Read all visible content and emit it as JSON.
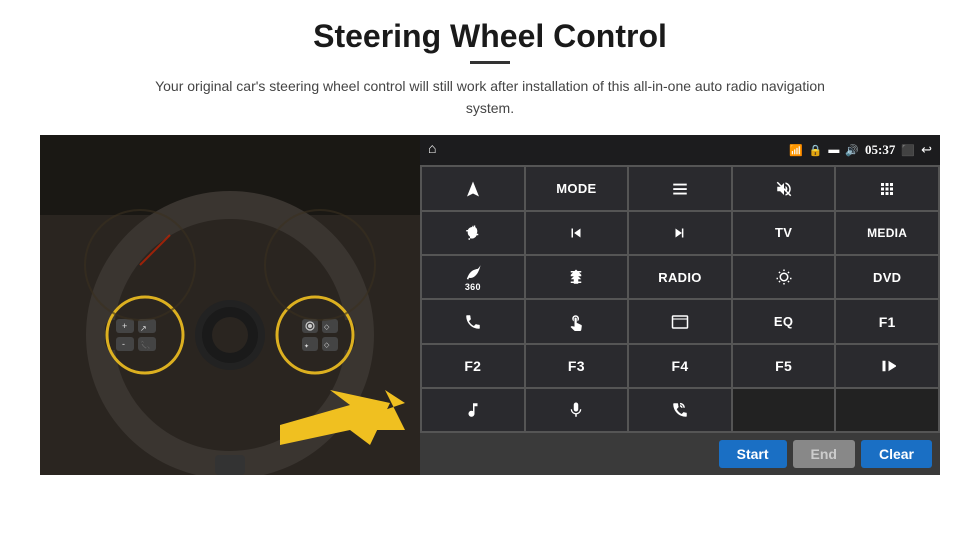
{
  "page": {
    "title": "Steering Wheel Control",
    "subtitle": "Your original car's steering wheel control will still work after installation of this all-in-one auto radio navigation system.",
    "divider": true
  },
  "status_bar": {
    "wifi_icon": "wifi",
    "lock_icon": "lock",
    "card_icon": "card",
    "bt_icon": "bluetooth-audio",
    "time": "05:37",
    "screen_icon": "screen",
    "back_icon": "back",
    "home_icon": "home"
  },
  "buttons": [
    {
      "id": "btn-home",
      "type": "icon",
      "label": "home",
      "row": 1,
      "col": 1
    },
    {
      "id": "btn-nav",
      "type": "icon",
      "label": "navigate",
      "row": 1,
      "col": 2
    },
    {
      "id": "btn-mode",
      "type": "text",
      "label": "MODE",
      "row": 1,
      "col": 3
    },
    {
      "id": "btn-list",
      "type": "icon",
      "label": "list",
      "row": 1,
      "col": 4
    },
    {
      "id": "btn-mute",
      "type": "icon",
      "label": "mute",
      "row": 1,
      "col": 5
    },
    {
      "id": "btn-apps",
      "type": "icon",
      "label": "apps",
      "row": 1,
      "col": 6
    },
    {
      "id": "btn-settings",
      "type": "icon",
      "label": "settings",
      "row": 2,
      "col": 1
    },
    {
      "id": "btn-prev",
      "type": "icon",
      "label": "previous",
      "row": 2,
      "col": 2
    },
    {
      "id": "btn-next",
      "type": "icon",
      "label": "next",
      "row": 2,
      "col": 3
    },
    {
      "id": "btn-tv",
      "type": "text",
      "label": "TV",
      "row": 2,
      "col": 4
    },
    {
      "id": "btn-media",
      "type": "text",
      "label": "MEDIA",
      "row": 2,
      "col": 5
    },
    {
      "id": "btn-360",
      "type": "text",
      "label": "360",
      "row": 3,
      "col": 1
    },
    {
      "id": "btn-eject",
      "type": "icon",
      "label": "eject",
      "row": 3,
      "col": 2
    },
    {
      "id": "btn-radio",
      "type": "text",
      "label": "RADIO",
      "row": 3,
      "col": 3
    },
    {
      "id": "btn-brightness",
      "type": "icon",
      "label": "brightness",
      "row": 3,
      "col": 4
    },
    {
      "id": "btn-dvd",
      "type": "text",
      "label": "DVD",
      "row": 3,
      "col": 5
    },
    {
      "id": "btn-phone",
      "type": "icon",
      "label": "phone",
      "row": 4,
      "col": 1
    },
    {
      "id": "btn-swipe",
      "type": "icon",
      "label": "swipe",
      "row": 4,
      "col": 2
    },
    {
      "id": "btn-resize",
      "type": "icon",
      "label": "resize",
      "row": 4,
      "col": 3
    },
    {
      "id": "btn-eq",
      "type": "text",
      "label": "EQ",
      "row": 4,
      "col": 4
    },
    {
      "id": "btn-f1",
      "type": "text",
      "label": "F1",
      "row": 4,
      "col": 5
    },
    {
      "id": "btn-f2",
      "type": "text",
      "label": "F2",
      "row": 5,
      "col": 1
    },
    {
      "id": "btn-f3",
      "type": "text",
      "label": "F3",
      "row": 5,
      "col": 2
    },
    {
      "id": "btn-f4",
      "type": "text",
      "label": "F4",
      "row": 5,
      "col": 3
    },
    {
      "id": "btn-f5",
      "type": "text",
      "label": "F5",
      "row": 5,
      "col": 4
    },
    {
      "id": "btn-playpause",
      "type": "icon",
      "label": "play-pause",
      "row": 5,
      "col": 5
    },
    {
      "id": "btn-music",
      "type": "icon",
      "label": "music",
      "row": 6,
      "col": 1
    },
    {
      "id": "btn-mic",
      "type": "icon",
      "label": "microphone",
      "row": 6,
      "col": 2
    },
    {
      "id": "btn-volume",
      "type": "icon",
      "label": "volume-call",
      "row": 6,
      "col": 3
    }
  ],
  "bottom_bar": {
    "start_label": "Start",
    "end_label": "End",
    "clear_label": "Clear"
  },
  "colors": {
    "accent_blue": "#1a6fc4",
    "panel_bg": "#1c1c1e",
    "btn_bg": "#2a2a2e",
    "status_bar_bg": "#1c1c1e",
    "bottom_bar_bg": "#3a3a3a"
  }
}
